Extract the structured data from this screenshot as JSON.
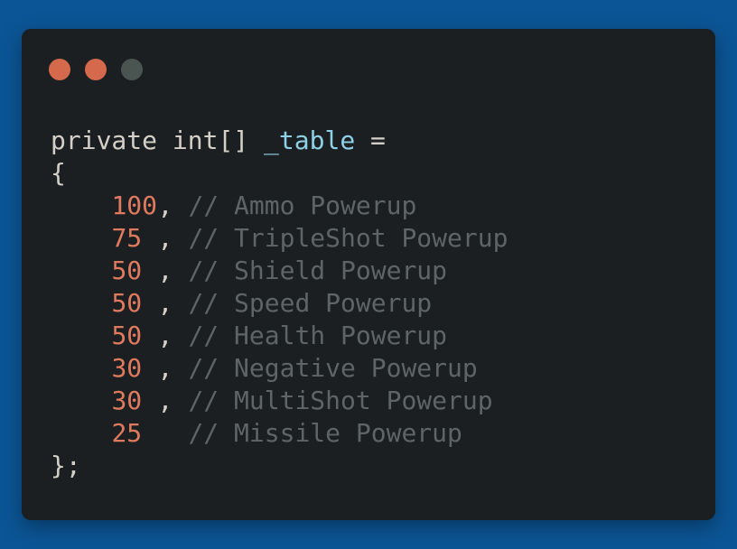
{
  "window": {
    "controls": [
      {
        "name": "close",
        "color": "#d4694c"
      },
      {
        "name": "minimize",
        "color": "#d4694c"
      },
      {
        "name": "maximize",
        "color": "#4a5450"
      }
    ]
  },
  "code": {
    "decl": {
      "keyword_private": "private",
      "type": "int[]",
      "variable": "_table",
      "assign": "="
    },
    "open_brace": "{",
    "entries": [
      {
        "value": "100",
        "sep": ",",
        "comment": "// Ammo Powerup"
      },
      {
        "value": "75",
        "sep": ",",
        "comment": "// TripleShot Powerup"
      },
      {
        "value": "50",
        "sep": ",",
        "comment": "// Shield Powerup"
      },
      {
        "value": "50",
        "sep": ",",
        "comment": "// Speed Powerup"
      },
      {
        "value": "50",
        "sep": ",",
        "comment": "// Health Powerup"
      },
      {
        "value": "30",
        "sep": ",",
        "comment": "// Negative Powerup"
      },
      {
        "value": "30",
        "sep": ",",
        "comment": "// MultiShot Powerup"
      },
      {
        "value": "25",
        "sep": "",
        "comment": "// Missile Powerup"
      }
    ],
    "close_brace": "};"
  }
}
